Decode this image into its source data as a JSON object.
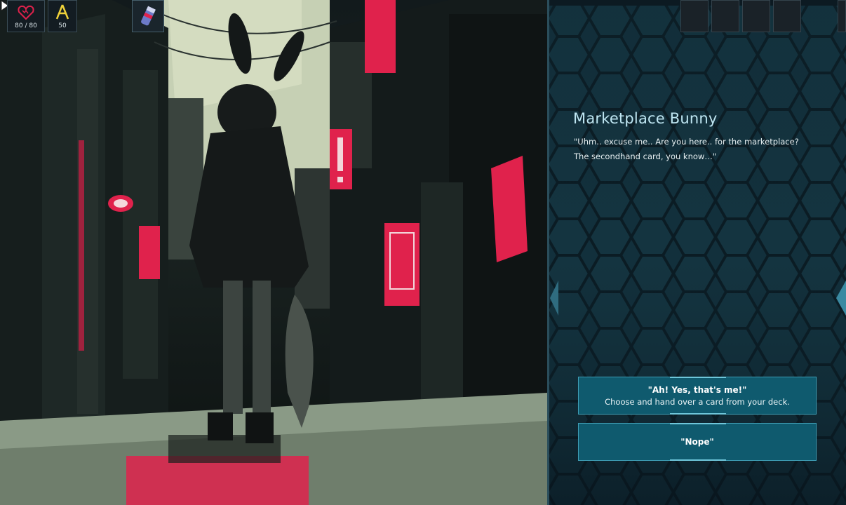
{
  "hud": {
    "hp_value": "80 / 80",
    "hp_icon": "heart-icon",
    "energy_value": "50",
    "energy_icon": "energy-icon",
    "relic_icon": "canister-icon"
  },
  "event": {
    "npc_name": "Marketplace Bunny",
    "dialogue_line1": "\"Uhm.. excuse me.. Are you here.. for the marketplace?",
    "dialogue_line2": "The secondhand card, you know…\""
  },
  "choices": [
    {
      "title": "\"Ah! Yes, that's me!\"",
      "description": "Choose and hand over a card from your deck."
    },
    {
      "title": "\"Nope\"",
      "description": ""
    }
  ],
  "colors": {
    "accent_red": "#e0224c",
    "panel_bg": "#12303c",
    "choice_bg": "#0f5a6e",
    "name_text": "#bfe6f2",
    "hp_icon": "#e0224c",
    "energy_icon": "#f0d23a"
  }
}
